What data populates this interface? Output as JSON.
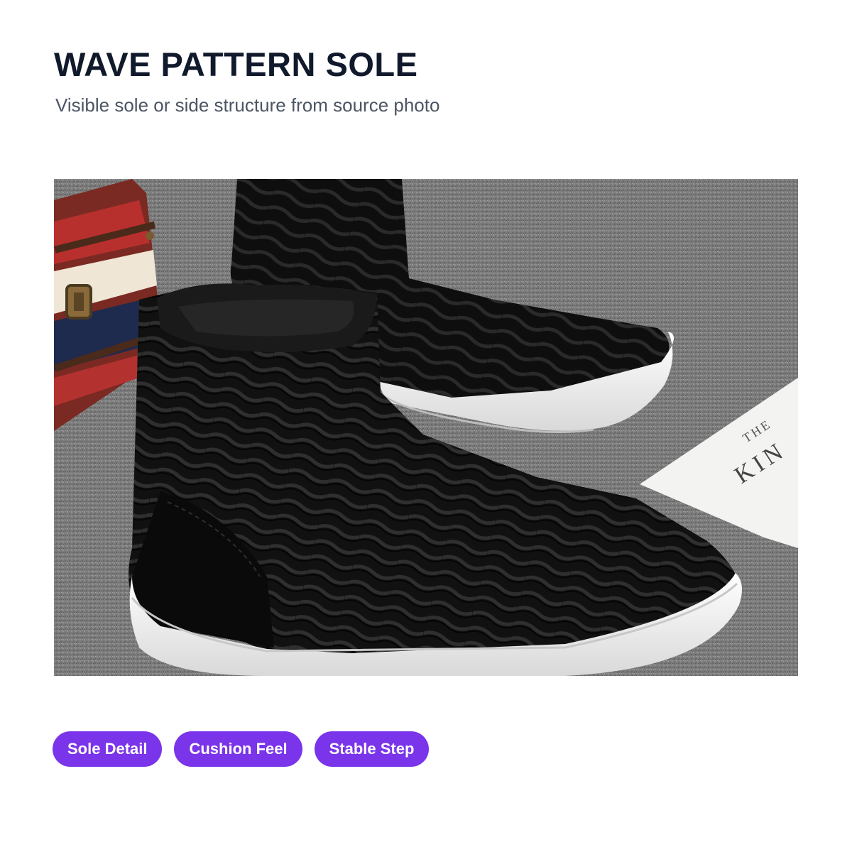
{
  "header": {
    "title": "WAVE PATTERN SOLE",
    "subtitle": "Visible sole or side structure from source photo"
  },
  "photo": {
    "subject": "black knit sock sneakers with white sole",
    "card_text_line1": "THE",
    "card_text_line2": "KIN"
  },
  "tags": [
    {
      "label": "Sole Detail"
    },
    {
      "label": "Cushion Feel"
    },
    {
      "label": "Stable Step"
    }
  ],
  "colors": {
    "title": "#111a2c",
    "subtitle": "#4b5563",
    "tag_bg": "#7a34ea",
    "tag_text": "#ffffff"
  }
}
